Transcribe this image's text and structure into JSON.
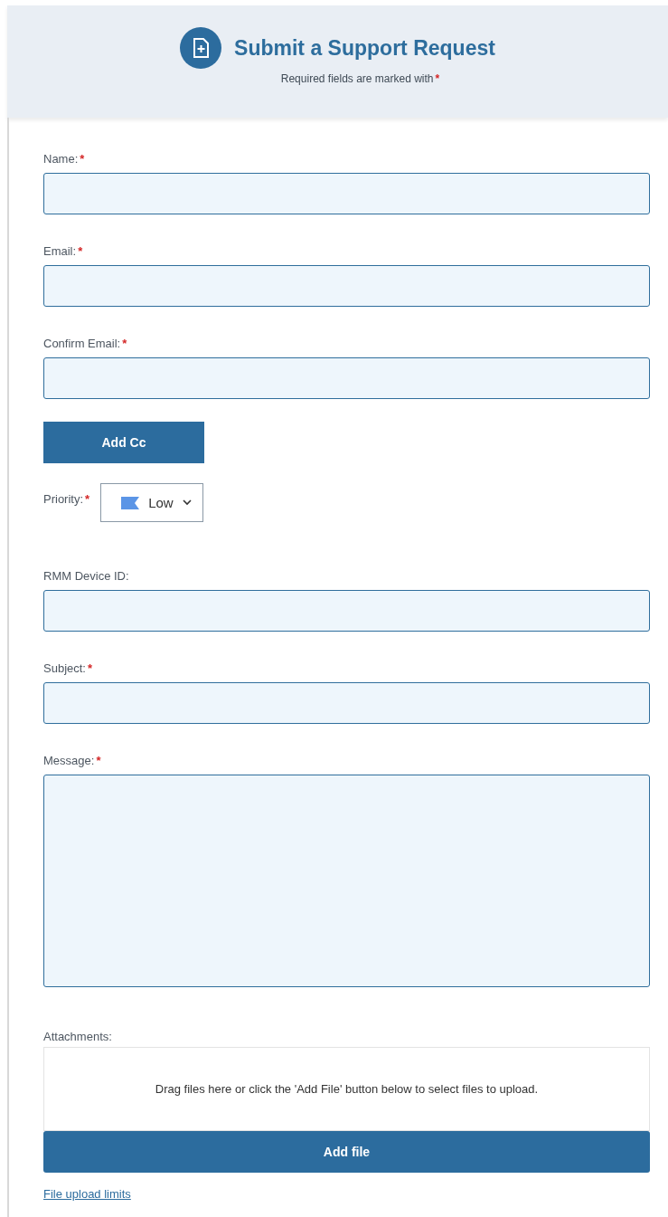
{
  "header": {
    "title": "Submit a Support Request",
    "subtitle": "Required fields are marked with",
    "required_mark": "*"
  },
  "fields": [
    {
      "kind": "text",
      "label": "Name:",
      "required_mark": "*"
    },
    {
      "kind": "text",
      "label": "Email:",
      "required_mark": "*"
    },
    {
      "kind": "text",
      "label": "Confirm Email:",
      "required_mark": "*"
    },
    {
      "kind": "button",
      "label": "Add Cc"
    },
    {
      "kind": "select",
      "label": "Priority:",
      "required_mark": "*",
      "value": "Low",
      "color": "#5b95e6"
    },
    {
      "kind": "text",
      "label": "RMM Device ID:"
    },
    {
      "kind": "text",
      "label": "Subject:",
      "required_mark": "*"
    },
    {
      "kind": "textarea",
      "label": "Message:",
      "required_mark": "*"
    }
  ],
  "attachments": {
    "label": "Attachments:",
    "drop_text": "Drag files here or click the 'Add File' button below to select files to upload.",
    "button": "Add file",
    "link": "File upload limits"
  }
}
